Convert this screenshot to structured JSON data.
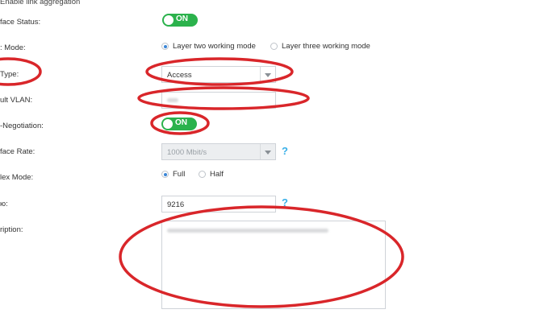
{
  "header": {
    "aggregation_hint": "Enable link aggregation"
  },
  "rows": {
    "interface_status": {
      "label": "face Status:",
      "toggle": "ON"
    },
    "port_mode": {
      "label": ": Mode:",
      "options": [
        "Layer two working mode",
        "Layer three working mode"
      ],
      "selected": 0
    },
    "type": {
      "label": "Type:",
      "value": "Access"
    },
    "default_vlan": {
      "label": "ult VLAN:"
    },
    "auto_negotiation": {
      "label": "-Negotiation:",
      "toggle": "ON"
    },
    "interface_rate": {
      "label": "face Rate:",
      "value": "1000 Mbit/s"
    },
    "duplex_mode": {
      "label": "lex Mode:",
      "options": [
        "Full",
        "Half"
      ],
      "selected": 0
    },
    "mtu": {
      "label": "ю:",
      "value": "9216"
    },
    "description": {
      "label": "ription:"
    }
  },
  "help_glyph": "?",
  "colors": {
    "toggle_on": "#2bb24c",
    "annotation": "#d9262a",
    "help": "#3ab0e8"
  }
}
